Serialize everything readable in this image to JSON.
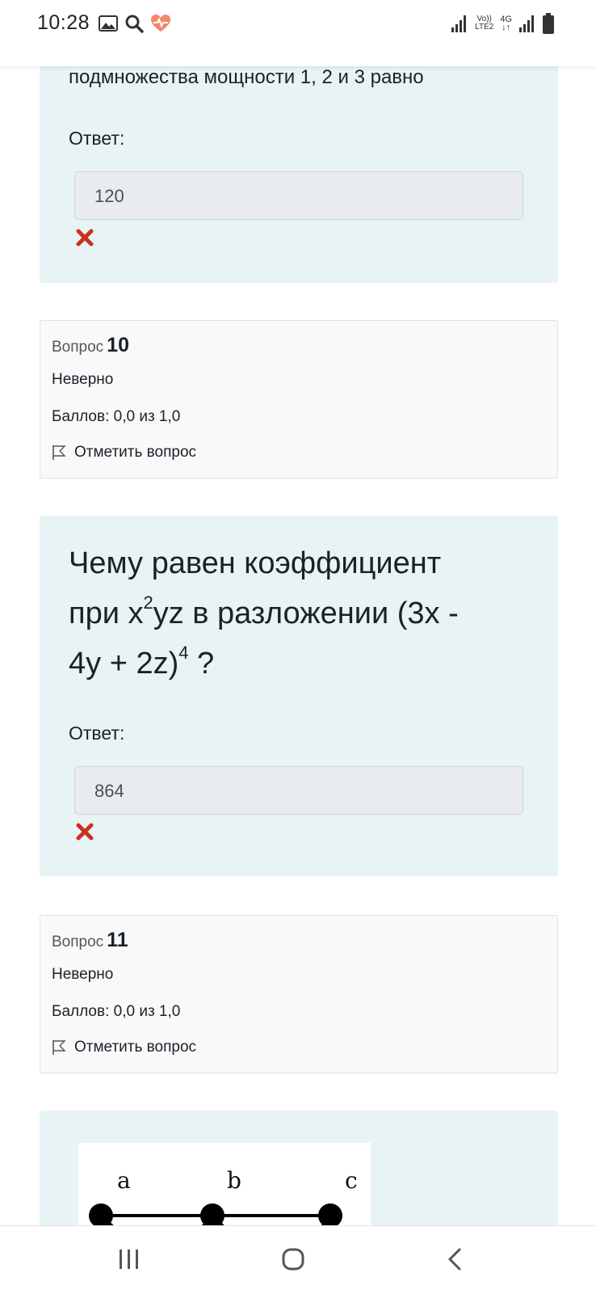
{
  "status_bar": {
    "time": "10:28",
    "lte_label_top": "Vo))",
    "lte_label_bottom": "LTE2",
    "net_label": "4G",
    "net_arrows": "↓↑"
  },
  "question9": {
    "text_tail": "подмножества мощности 1, 2 и 3 равно",
    "answer_label": "Ответ:",
    "answer_value": "120"
  },
  "question10_info": {
    "prefix": "Вопрос",
    "number": "10",
    "state": "Неверно",
    "grade": "Баллов: 0,0 из 1,0",
    "flag_label": "Отметить вопрос"
  },
  "question10": {
    "line1": "Чему равен коэффициент",
    "line2_a": "при x",
    "line2_sup": "2",
    "line2_b": "yz в разложении (3x -",
    "line3_a": "4y + 2z)",
    "line3_sup": "4",
    "line3_b": " ?",
    "answer_label": "Ответ:",
    "answer_value": "864"
  },
  "question11_info": {
    "prefix": "Вопрос",
    "number": "11",
    "state": "Неверно",
    "grade": "Баллов: 0,0 из 1,0",
    "flag_label": "Отметить вопрос"
  },
  "question11": {
    "graph_labels": [
      "a",
      "b",
      "c"
    ]
  },
  "colors": {
    "question_bg": "#e7f3f5",
    "info_bg": "#f8f9fa",
    "incorrect_mark": "#ca3120"
  }
}
